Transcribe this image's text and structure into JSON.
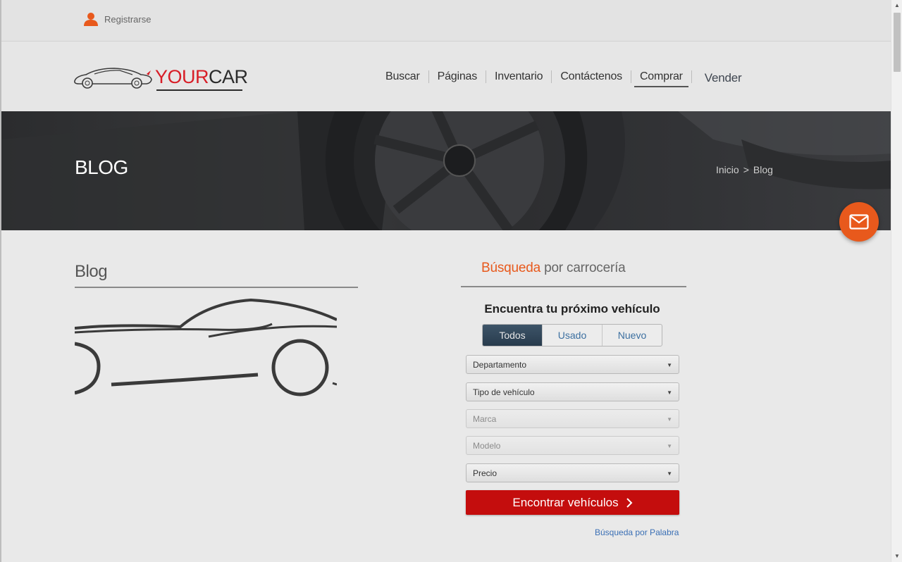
{
  "topbar": {
    "register_label": "Registrarse"
  },
  "logo": {
    "part1": "YOUR",
    "part2": "CAR"
  },
  "nav": {
    "items": [
      "Buscar",
      "Páginas",
      "Inventario",
      "Contáctenos",
      "Comprar"
    ],
    "sell": "Vender",
    "active": "Comprar"
  },
  "banner": {
    "title": "BLOG",
    "breadcrumb": {
      "home": "Inicio",
      "separator": ">",
      "current": "Blog"
    }
  },
  "blog": {
    "heading": "Blog"
  },
  "search": {
    "heading_accent": "Búsqueda",
    "heading_rest": "por carrocería",
    "subtitle": "Encuentra tu próximo vehículo",
    "tabs": [
      "Todos",
      "Usado",
      "Nuevo"
    ],
    "active_tab": "Todos",
    "selects": {
      "departamento": "Departamento",
      "tipo": "Tipo de vehículo",
      "marca": "Marca",
      "modelo": "Modelo",
      "precio": "Precio"
    },
    "submit_label": "Encontrar vehículos",
    "keyword_link": "Búsqueda por Palabra"
  },
  "colors": {
    "accent_orange": "#e8591c",
    "brand_red": "#d81e27",
    "button_red": "#c40d0d",
    "tab_active": "#2f4457"
  },
  "icons": {
    "register": "user-icon",
    "mail": "mail-icon",
    "chevron": "chevron-right-icon",
    "dropdown": "caret-down-icon"
  }
}
